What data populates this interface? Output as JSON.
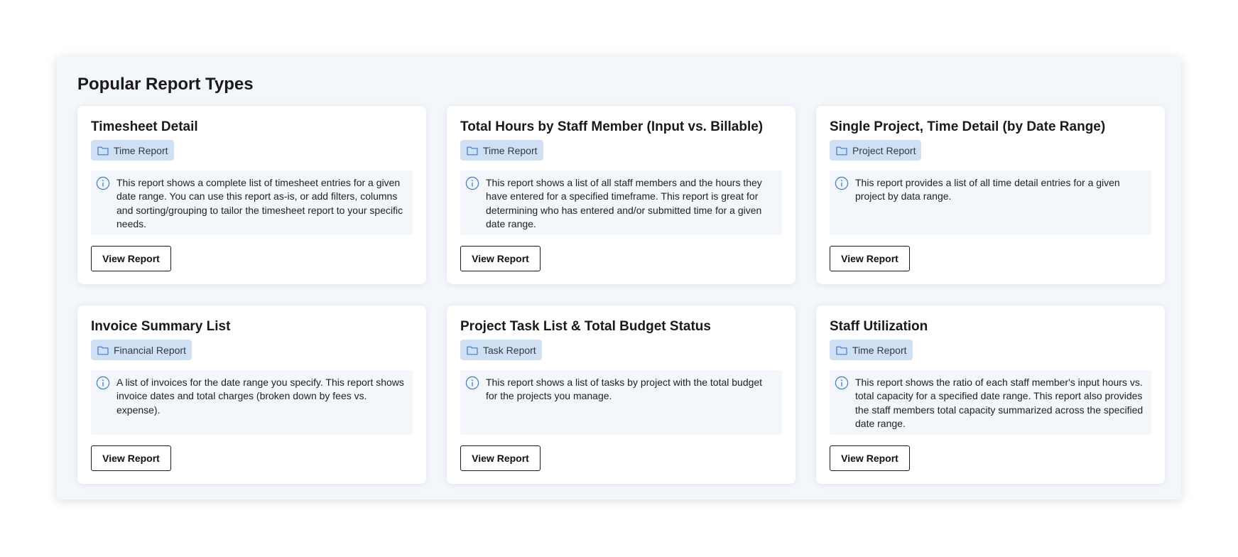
{
  "page": {
    "title": "Popular Report Types"
  },
  "icons": {
    "badge": "folder-icon",
    "description": "info-icon",
    "accent_color": "#3a7bd5"
  },
  "reports": [
    {
      "title": "Timesheet Detail",
      "category": "Time Report",
      "description": "This report shows a complete list of timesheet entries for a given date range. You can use this report as-is, or add filters, columns and sorting/grouping to tailor the timesheet report to your specific needs.",
      "button_label": "View Report"
    },
    {
      "title": "Total Hours by Staff Member (Input vs. Billable)",
      "category": "Time Report",
      "description": "This report shows a list of all staff members and the hours they have entered for a specified timeframe. This report is great for determining who has entered and/or submitted time for a given date range.",
      "button_label": "View Report"
    },
    {
      "title": "Single Project, Time Detail (by Date Range)",
      "category": "Project Report",
      "description": "This report provides a list of all time detail entries for a given project by data range.",
      "button_label": "View Report"
    },
    {
      "title": "Invoice Summary List",
      "category": "Financial Report",
      "description": "A list of invoices for the date range you specify. This report shows invoice dates and total charges (broken down by fees vs. expense).",
      "button_label": "View Report"
    },
    {
      "title": "Project Task List & Total Budget Status",
      "category": "Task Report",
      "description": "This report shows a list of tasks by project with the total budget for the projects you manage.",
      "button_label": "View Report"
    },
    {
      "title": "Staff Utilization",
      "category": "Time Report",
      "description": "This report shows the ratio of each staff member's input hours vs. total capacity for a specified date range. This report also provides the staff members total capacity summarized across the specified date range.",
      "button_label": "View Report"
    }
  ]
}
